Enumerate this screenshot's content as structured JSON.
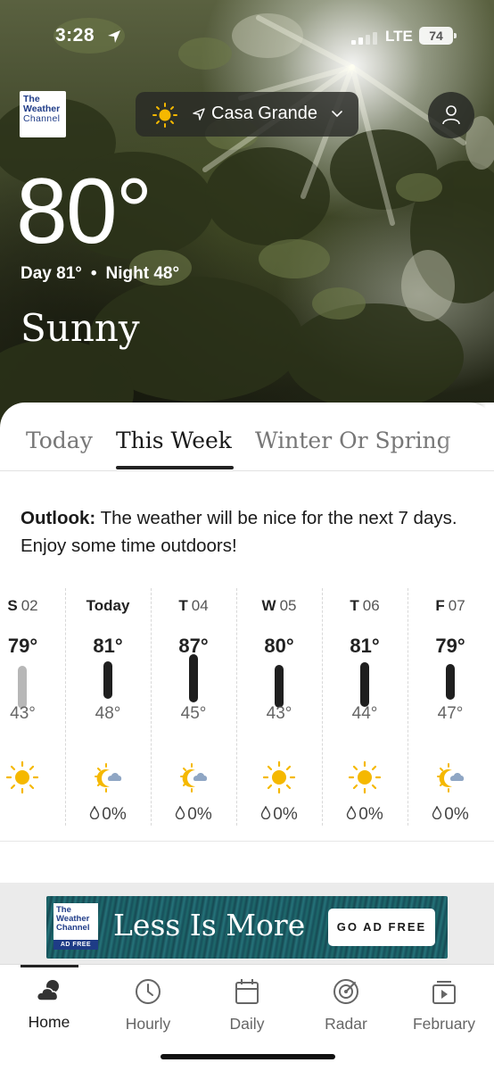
{
  "status_bar": {
    "time": "3:28",
    "network": "LTE",
    "battery": "74"
  },
  "brand": {
    "logo_lines": [
      "The",
      "Weather",
      "Channel"
    ]
  },
  "location": {
    "name": "Casa Grande"
  },
  "current": {
    "temperature": "80°",
    "day_label": "Day 81°",
    "separator": "•",
    "night_label": "Night 48°",
    "condition": "Sunny"
  },
  "tabs": [
    {
      "label": "Today"
    },
    {
      "label": "This Week",
      "active": true
    },
    {
      "label": "Winter Or Spring"
    }
  ],
  "outlook": {
    "label": "Outlook:",
    "text": " The weather will be nice for the next 7 days. Enjoy some time outdoors!"
  },
  "forecast": [
    {
      "day": "S",
      "date": "02",
      "high": "79°",
      "low": "43°",
      "icon": "sun-icon",
      "precip": "",
      "bar_color": "gray"
    },
    {
      "day": "Today",
      "date": "",
      "high": "81°",
      "low": "48°",
      "icon": "partly-cloudy-night-icon",
      "precip": "0%",
      "bar_color": "dark"
    },
    {
      "day": "T",
      "date": "04",
      "high": "87°",
      "low": "45°",
      "icon": "partly-cloudy-night-icon",
      "precip": "0%",
      "bar_color": "dark"
    },
    {
      "day": "W",
      "date": "05",
      "high": "80°",
      "low": "43°",
      "icon": "sun-icon",
      "precip": "0%",
      "bar_color": "dark"
    },
    {
      "day": "T",
      "date": "06",
      "high": "81°",
      "low": "44°",
      "icon": "sun-icon",
      "precip": "0%",
      "bar_color": "dark"
    },
    {
      "day": "F",
      "date": "07",
      "high": "79°",
      "low": "47°",
      "icon": "partly-cloudy-night-icon",
      "precip": "0%",
      "bar_color": "dark"
    }
  ],
  "ad": {
    "logo_lines": [
      "The",
      "Weather",
      "Channel"
    ],
    "logo_tag": "AD FREE",
    "headline": "Less Is More",
    "cta": "GO AD FREE"
  },
  "bottom_nav": [
    {
      "label": "Home",
      "icon": "cloud-sun-icon",
      "active": true
    },
    {
      "label": "Hourly",
      "icon": "clock-icon"
    },
    {
      "label": "Daily",
      "icon": "calendar-icon"
    },
    {
      "label": "Radar",
      "icon": "radar-icon"
    },
    {
      "label": "February",
      "icon": "video-icon"
    }
  ],
  "colors": {
    "sun": "#f5b800",
    "cloud": "#8fa6c4",
    "bar": "#1f1f1f",
    "bar_past": "#b7b7b7",
    "ad_bg": "#174f5a"
  }
}
